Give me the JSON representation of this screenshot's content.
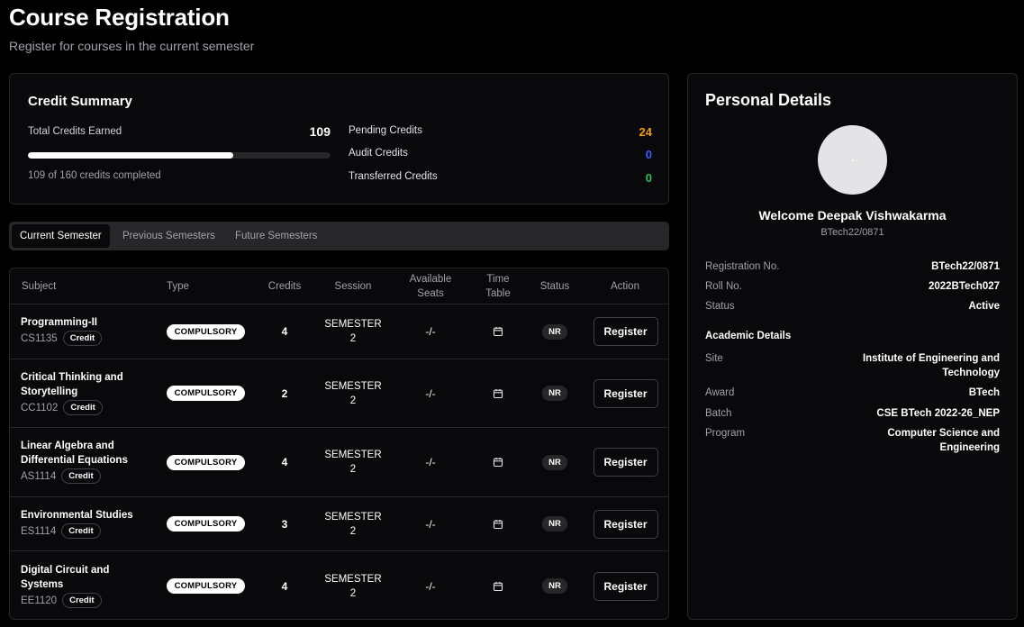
{
  "page": {
    "title": "Course Registration",
    "subtitle": "Register for courses in the current semester"
  },
  "credit_summary": {
    "title": "Credit Summary",
    "earned_label": "Total Credits Earned",
    "earned_value": "109",
    "progress_fraction": 0.68,
    "progress_text": "109 of 160 credits completed",
    "pending_label": "Pending Credits",
    "pending_value": "24",
    "pending_color": "#f59e0b",
    "audit_label": "Audit Credits",
    "audit_value": "0",
    "audit_color": "#3b5bff",
    "transferred_label": "Transferred Credits",
    "transferred_value": "0",
    "transferred_color": "#22c55e"
  },
  "tabs": [
    {
      "label": "Current Semester",
      "active": true
    },
    {
      "label": "Previous Semesters",
      "active": false
    },
    {
      "label": "Future Semesters",
      "active": false
    }
  ],
  "table": {
    "headers": {
      "subject": "Subject",
      "type": "Type",
      "credits": "Credits",
      "session": "Session",
      "seats_line1": "Available",
      "seats_line2": "Seats",
      "timetable_line1": "Time",
      "timetable_line2": "Table",
      "status": "Status",
      "action": "Action"
    },
    "rows": [
      {
        "name_line1": "Programming-II",
        "name_line2": "",
        "code": "CS1135",
        "credit_badge": "Credit",
        "type": "COMPULSORY",
        "credits": "4",
        "session_line1": "SEMESTER",
        "session_line2": "2",
        "seats": "-/-",
        "timetable_icon": "calendar-icon",
        "status": "NR",
        "action": "Register"
      },
      {
        "name_line1": "Critical Thinking and",
        "name_line2": "Storytelling",
        "code": "CC1102",
        "credit_badge": "Credit",
        "type": "COMPULSORY",
        "credits": "2",
        "session_line1": "SEMESTER",
        "session_line2": "2",
        "seats": "-/-",
        "timetable_icon": "calendar-icon",
        "status": "NR",
        "action": "Register"
      },
      {
        "name_line1": "Linear Algebra and",
        "name_line2": "Differential Equations",
        "code": "AS1114",
        "credit_badge": "Credit",
        "type": "COMPULSORY",
        "credits": "4",
        "session_line1": "SEMESTER",
        "session_line2": "2",
        "seats": "-/-",
        "timetable_icon": "calendar-icon",
        "status": "NR",
        "action": "Register"
      },
      {
        "name_line1": "Environmental Studies",
        "name_line2": "",
        "code": "ES1114",
        "credit_badge": "Credit",
        "type": "COMPULSORY",
        "credits": "3",
        "session_line1": "SEMESTER",
        "session_line2": "2",
        "seats": "-/-",
        "timetable_icon": "calendar-icon",
        "status": "NR",
        "action": "Register"
      },
      {
        "name_line1": "Digital Circuit and",
        "name_line2": "Systems",
        "code": "EE1120",
        "credit_badge": "Credit",
        "type": "COMPULSORY",
        "credits": "4",
        "session_line1": "SEMESTER",
        "session_line2": "2",
        "seats": "-/-",
        "timetable_icon": "calendar-icon",
        "status": "NR",
        "action": "Register"
      }
    ]
  },
  "personal": {
    "title": "Personal Details",
    "avatar_icon": "user-avatar-icon",
    "welcome": "Welcome Deepak Vishwakarma",
    "welcome_sub": "BTech22/0871",
    "registration_label": "Registration No.",
    "registration_value": "BTech22/0871",
    "roll_label": "Roll No.",
    "roll_value": "2022BTech027",
    "status_label": "Status",
    "status_value": "Active",
    "academic_title": "Academic Details",
    "site_label": "Site",
    "site_value_line1": "Institute of Engineering and",
    "site_value_line2": "Technology",
    "award_label": "Award",
    "award_value": "BTech",
    "batch_label": "Batch",
    "batch_value": "CSE BTech 2022-26_NEP",
    "program_label": "Program",
    "program_value_line1": "Computer Science and",
    "program_value_line2": "Engineering"
  }
}
